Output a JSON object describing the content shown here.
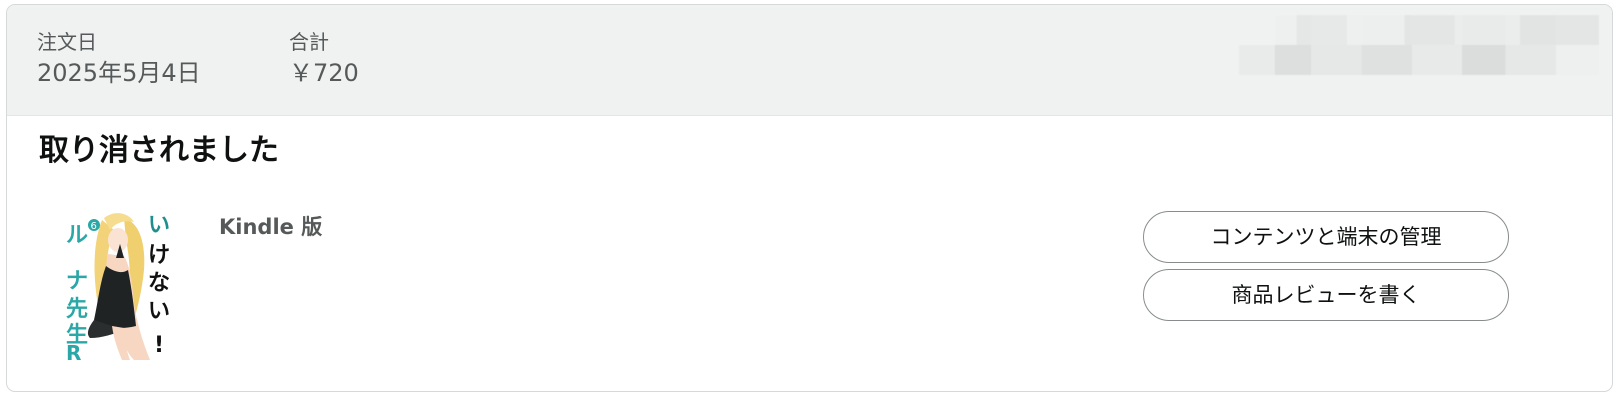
{
  "order_header": {
    "order_date_label": "注文日",
    "order_date_value": "2025年5月4日",
    "total_label": "合計",
    "total_value": "￥720"
  },
  "status": {
    "title": "取り消されました"
  },
  "item": {
    "format": "Kindle 版",
    "cover_text": "いけないルナ先生R",
    "cover_volume": "6"
  },
  "actions": {
    "manage_content_label": "コンテンツと端末の管理",
    "write_review_label": "商品レビューを書く"
  },
  "colors": {
    "header_bg": "#f0f2f2",
    "cover_accent": "#2aa7a6"
  }
}
